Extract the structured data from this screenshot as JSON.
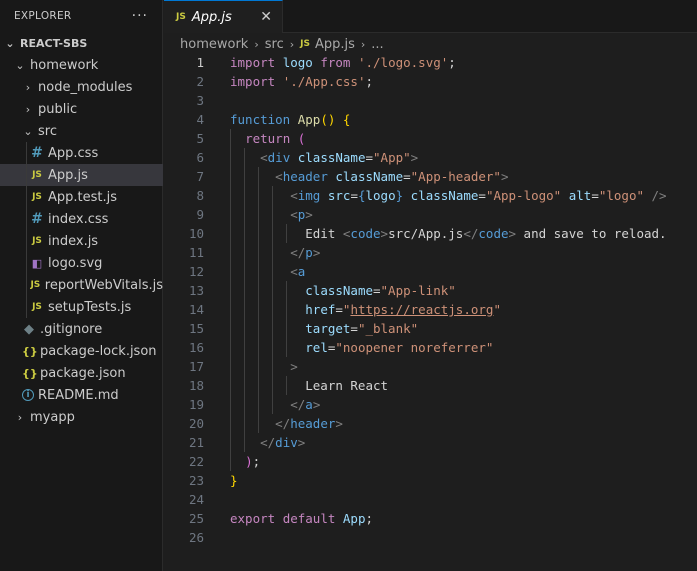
{
  "explorer": {
    "title": "EXPLORER",
    "more": "···"
  },
  "tree": [
    {
      "label": "REACT-SBS",
      "kind": "root",
      "chev": "⌄"
    },
    {
      "label": "homework",
      "kind": "folder",
      "chev": "⌄"
    },
    {
      "label": "node_modules",
      "kind": "folder",
      "chev": "›"
    },
    {
      "label": "public",
      "kind": "folder",
      "chev": "›"
    },
    {
      "label": "src",
      "kind": "folder",
      "chev": "⌄"
    },
    {
      "label": "App.css",
      "kind": "css",
      "icon": "#"
    },
    {
      "label": "App.js",
      "kind": "js",
      "icon": "JS"
    },
    {
      "label": "App.test.js",
      "kind": "js",
      "icon": "JS"
    },
    {
      "label": "index.css",
      "kind": "css",
      "icon": "#"
    },
    {
      "label": "index.js",
      "kind": "js",
      "icon": "JS"
    },
    {
      "label": "logo.svg",
      "kind": "svg",
      "icon": "◧"
    },
    {
      "label": "reportWebVitals.js",
      "kind": "js",
      "icon": "JS"
    },
    {
      "label": "setupTests.js",
      "kind": "js",
      "icon": "JS"
    },
    {
      "label": ".gitignore",
      "kind": "git",
      "icon": "◆"
    },
    {
      "label": "package-lock.json",
      "kind": "json",
      "icon": "{}"
    },
    {
      "label": "package.json",
      "kind": "json",
      "icon": "{}"
    },
    {
      "label": "README.md",
      "kind": "info",
      "icon": "i"
    },
    {
      "label": "myapp",
      "kind": "folder",
      "chev": "›"
    }
  ],
  "tab": {
    "icon": "JS",
    "name": "App.js",
    "close": "✕"
  },
  "breadcrumb": {
    "parts": [
      "homework",
      "src"
    ],
    "file_icon": "JS",
    "file": "App.js",
    "symbol": "..."
  },
  "line_numbers": [
    "1",
    "2",
    "3",
    "4",
    "5",
    "6",
    "7",
    "8",
    "9",
    "10",
    "11",
    "12",
    "13",
    "14",
    "15",
    "16",
    "17",
    "18",
    "19",
    "20",
    "21",
    "22",
    "23",
    "24",
    "25",
    "26"
  ],
  "active_line": "1",
  "colors": {
    "keyword": "#c586c0",
    "tag": "#569cd6",
    "attribute": "#9cdcfe",
    "string": "#ce9178",
    "function": "#dcdcaa",
    "bracket": "#ffd700",
    "accent": "#0078d4"
  }
}
